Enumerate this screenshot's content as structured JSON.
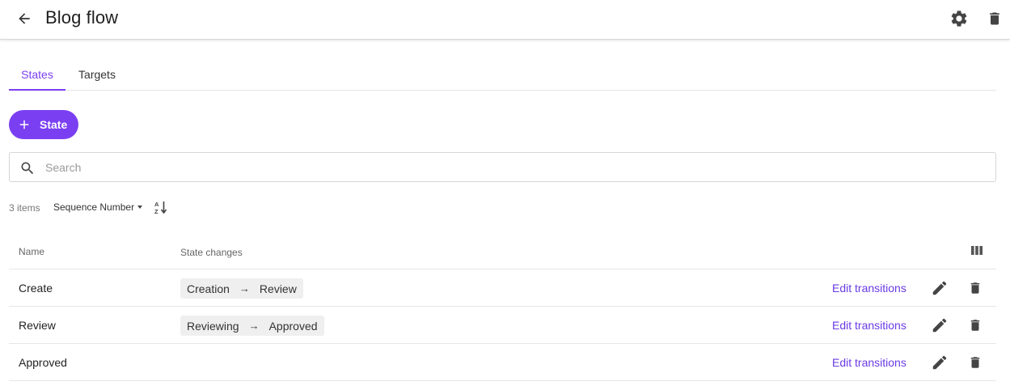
{
  "header": {
    "title": "Blog flow",
    "back_icon": "arrow-left-icon",
    "settings_icon": "gear-icon",
    "delete_icon": "trash-icon"
  },
  "tabs": [
    {
      "label": "States",
      "active": true
    },
    {
      "label": "Targets",
      "active": false
    }
  ],
  "add_button": {
    "label": "State",
    "icon": "plus-icon"
  },
  "search": {
    "placeholder": "Search",
    "value": ""
  },
  "list_meta": {
    "count_label": "3 items",
    "sort_by": "Sequence Number",
    "sort_direction_icon": "sort-alpha-down-icon"
  },
  "table": {
    "columns": [
      "Name",
      "State changes"
    ],
    "rows": [
      {
        "name": "Create",
        "change_from": "Creation",
        "change_to": "Review",
        "action_label": "Edit transitions"
      },
      {
        "name": "Review",
        "change_from": "Reviewing",
        "change_to": "Approved",
        "action_label": "Edit transitions"
      },
      {
        "name": "Approved",
        "change_from": "",
        "change_to": "",
        "action_label": "Edit transitions"
      }
    ],
    "arrow": "→"
  },
  "colors": {
    "accent": "#7b3ff2",
    "link": "#6a3be4",
    "icon": "#444444"
  }
}
